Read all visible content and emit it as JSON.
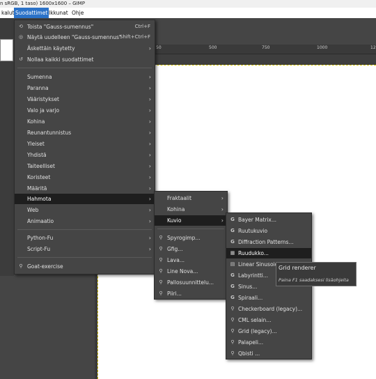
{
  "window": {
    "title": "n sRGB, 1 taso) 1600x1600 – GIMP"
  },
  "menubar": {
    "items": [
      {
        "label": "kalut"
      },
      {
        "label": "Suodattimet",
        "active": true
      },
      {
        "label": "Ikkunat"
      },
      {
        "label": "Ohje"
      }
    ]
  },
  "ruler": {
    "labels": [
      "50",
      "500",
      "750",
      "1000",
      "125"
    ]
  },
  "filters_menu": {
    "items": [
      {
        "label": "Toista \"Gauss-sumennus\"",
        "shortcut": "Ctrl+F",
        "icon": "repeat-icon"
      },
      {
        "label": "Näytä uudelleen \"Gauss-sumennus\"",
        "shortcut": "Shift+Ctrl+F",
        "icon": "reshow-icon"
      },
      {
        "label": "Äskettäin käytetty",
        "submenu": true
      },
      {
        "label": "Nollaa kaikki suodattimet",
        "icon": "reset-icon"
      },
      {
        "label": "Sumenna",
        "submenu": true
      },
      {
        "label": "Paranna",
        "submenu": true
      },
      {
        "label": "Vääristykset",
        "submenu": true
      },
      {
        "label": "Valo ja varjo",
        "submenu": true
      },
      {
        "label": "Kohina",
        "submenu": true
      },
      {
        "label": "Reunantunnistus",
        "submenu": true
      },
      {
        "label": "Yleiset",
        "submenu": true
      },
      {
        "label": "Yhdistä",
        "submenu": true
      },
      {
        "label": "Taiteelliset",
        "submenu": true
      },
      {
        "label": "Koristeet",
        "submenu": true
      },
      {
        "label": "Määritä",
        "submenu": true
      },
      {
        "label": "Hahmota",
        "submenu": true,
        "highlighted": true
      },
      {
        "label": "Web",
        "submenu": true
      },
      {
        "label": "Animaatio",
        "submenu": true
      },
      {
        "label": "Python-Fu",
        "submenu": true
      },
      {
        "label": "Script-Fu",
        "submenu": true
      },
      {
        "label": "Goat-exercise",
        "icon": "plugin-icon"
      }
    ]
  },
  "render_menu": {
    "items": [
      {
        "label": "Fraktaalit",
        "submenu": true
      },
      {
        "label": "Kohina",
        "submenu": true
      },
      {
        "label": "Kuvio",
        "submenu": true,
        "highlighted": true
      },
      {
        "label": "Spyrogimp...",
        "icon": "plugin-icon"
      },
      {
        "label": "Gfig...",
        "icon": "plugin-icon"
      },
      {
        "label": "Lava...",
        "icon": "plugin-icon"
      },
      {
        "label": "Line Nova...",
        "icon": "plugin-icon"
      },
      {
        "label": "Pallosuunnittelu...",
        "icon": "plugin-icon"
      },
      {
        "label": "Piiri...",
        "icon": "plugin-icon"
      }
    ]
  },
  "pattern_menu": {
    "items": [
      {
        "label": "Bayer Matrix...",
        "icon": "gegl-icon"
      },
      {
        "label": "Ruutukuvio",
        "icon": "gegl-icon"
      },
      {
        "label": "Diffraction Patterns...",
        "icon": "gegl-icon"
      },
      {
        "label": "Ruudukko...",
        "icon": "grid-icon",
        "highlighted": true
      },
      {
        "label": "Linear Sinusoid...",
        "icon": "sinusoid-icon"
      },
      {
        "label": "Labyrintti...",
        "icon": "gegl-icon"
      },
      {
        "label": "Sinus...",
        "icon": "gegl-icon"
      },
      {
        "label": "Spiraali...",
        "icon": "gegl-icon"
      },
      {
        "label": "Checkerboard (legacy)...",
        "icon": "plugin-icon"
      },
      {
        "label": "CML selain...",
        "icon": "plugin-icon"
      },
      {
        "label": "Grid (legacy)...",
        "icon": "plugin-icon"
      },
      {
        "label": "Palapeli...",
        "icon": "plugin-icon"
      },
      {
        "label": "Qbisti ...",
        "icon": "plugin-icon"
      }
    ]
  },
  "tooltip": {
    "title": "Grid renderer",
    "hint": "Paina F1 saadaksesi lisäohjeita"
  }
}
